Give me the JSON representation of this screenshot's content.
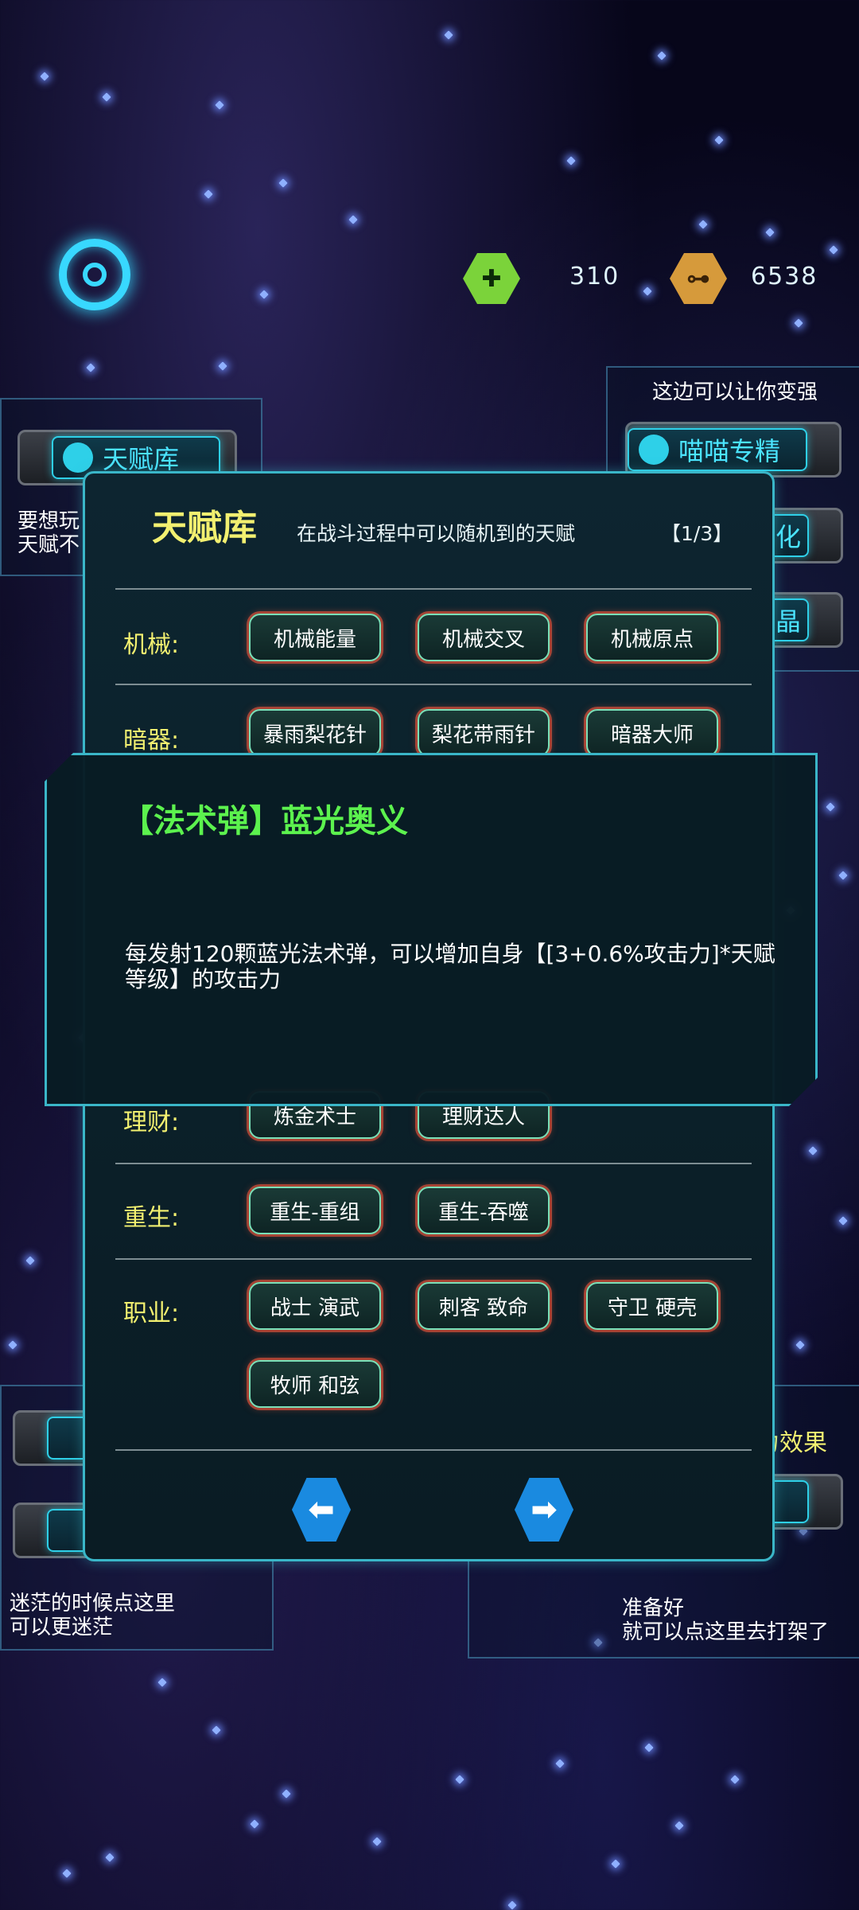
{
  "hud": {
    "resource_1": {
      "icon": "syringe-icon",
      "value": "310"
    },
    "resource_2": {
      "icon": "ticket-icon",
      "value": "6538"
    }
  },
  "background": {
    "talent_button_label": "天赋库",
    "talent_hint_line1": "要想玩",
    "talent_hint_line2": "天赋不",
    "top_right_hint": "这边可以让你变强",
    "mastery_button_label": "喵喵专精",
    "partial_label_1": "化",
    "partial_label_2": "晶",
    "bottom_left_hint_line1": "迷茫的时候点这里",
    "bottom_left_hint_line2": "可以更迷茫",
    "bottom_right_effect": "有强力效果",
    "bottom_right_hint_line1": "准备好",
    "bottom_right_hint_line2": "就可以点这里去打架了"
  },
  "dialog": {
    "title": "天赋库",
    "subtitle": "在战斗过程中可以随机到的天赋",
    "page": "【1/3】",
    "rows": [
      {
        "label": "机械:",
        "tags": [
          "机械能量",
          "机械交叉",
          "机械原点"
        ]
      },
      {
        "label": "暗器:",
        "tags": [
          "暴雨梨花针",
          "梨花带雨针",
          "暗器大师"
        ]
      },
      {
        "label": "理财:",
        "tags": [
          "炼金术士",
          "理财达人"
        ]
      },
      {
        "label": "重生:",
        "tags": [
          "重生-重组",
          "重生-吞噬"
        ]
      },
      {
        "label": "职业:",
        "tags": [
          "战士 演武",
          "刺客 致命",
          "守卫 硬壳",
          "牧师 和弦"
        ]
      }
    ]
  },
  "tooltip": {
    "title": "【法术弹】蓝光奥义",
    "description": "每发射120颗蓝光法术弹，可以增加自身【[3+0.6%攻击力]*天赋等级】的攻击力"
  },
  "colors": {
    "accent_cyan": "#3ab6c8",
    "title_yellow": "#f2f070",
    "tooltip_green": "#5cf24e",
    "tag_glow_red": "#ff5a3c"
  }
}
